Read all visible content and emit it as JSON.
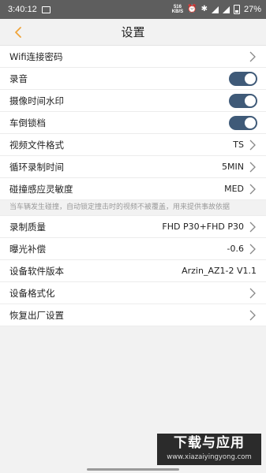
{
  "status_bar": {
    "time": "3:40:12",
    "net_speed_top": "516",
    "net_speed_bottom": "KB/S",
    "battery_percent": "27%"
  },
  "nav": {
    "title": "设置",
    "back_icon": "chevron-left-icon",
    "accent_color": "#f0a43a"
  },
  "settings": {
    "wifi_password": {
      "label": "Wifi连接密码"
    },
    "audio": {
      "label": "录音",
      "enabled": true
    },
    "time_watermark": {
      "label": "摄像时间水印",
      "enabled": true
    },
    "reverse_lock": {
      "label": "车倒锁档",
      "enabled": true
    },
    "video_format": {
      "label": "视频文件格式",
      "value": "TS"
    },
    "loop_record": {
      "label": "循环录制时间",
      "value": "5MIN"
    },
    "collision_sensitivity": {
      "label": "碰撞感应灵敏度",
      "value": "MED"
    },
    "collision_note": "当车辆发生碰撞，自动锁定撞击时的视频不被覆盖，用来提供事故依据",
    "record_quality": {
      "label": "录制质量",
      "value": "FHD P30+FHD P30"
    },
    "exposure": {
      "label": "曝光补偿",
      "value": "-0.6"
    },
    "firmware": {
      "label": "设备软件版本",
      "value": "Arzin_AZ1-2 V1.1"
    },
    "format_device": {
      "label": "设备格式化"
    },
    "factory_reset": {
      "label": "恢复出厂设置"
    }
  },
  "toggle_color": "#3f5a78",
  "watermark": {
    "main": "下载与应用",
    "url": "www.xiazaiyingyong.com"
  }
}
